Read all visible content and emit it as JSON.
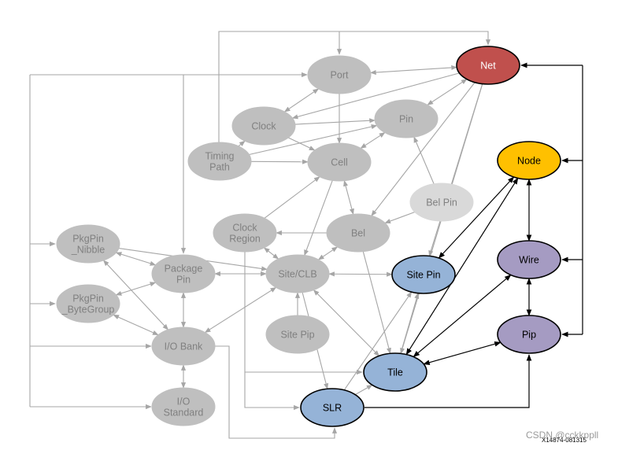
{
  "nodes": [
    {
      "id": "port",
      "label": [
        "Port"
      ],
      "fill": "#bfbfbf",
      "text": "#808080",
      "stroke": "#bfbfbf"
    },
    {
      "id": "net",
      "label": [
        "Net"
      ],
      "fill": "#c0504d",
      "text": "#ffffff",
      "stroke": "#000000"
    },
    {
      "id": "clock",
      "label": [
        "Clock"
      ],
      "fill": "#bfbfbf",
      "text": "#808080",
      "stroke": "#bfbfbf"
    },
    {
      "id": "pin",
      "label": [
        "Pin"
      ],
      "fill": "#bfbfbf",
      "text": "#808080",
      "stroke": "#bfbfbf"
    },
    {
      "id": "timing",
      "label": [
        "Timing",
        "Path"
      ],
      "fill": "#bfbfbf",
      "text": "#808080",
      "stroke": "#bfbfbf"
    },
    {
      "id": "cell",
      "label": [
        "Cell"
      ],
      "fill": "#bfbfbf",
      "text": "#808080",
      "stroke": "#bfbfbf"
    },
    {
      "id": "node",
      "label": [
        "Node"
      ],
      "fill": "#ffc000",
      "text": "#000000",
      "stroke": "#000000"
    },
    {
      "id": "belpin",
      "label": [
        "Bel Pin"
      ],
      "fill": "#d9d9d9",
      "text": "#808080",
      "stroke": "#d9d9d9"
    },
    {
      "id": "clkreg",
      "label": [
        "Clock",
        "Region"
      ],
      "fill": "#bfbfbf",
      "text": "#808080",
      "stroke": "#bfbfbf"
    },
    {
      "id": "bel",
      "label": [
        "Bel"
      ],
      "fill": "#bfbfbf",
      "text": "#808080",
      "stroke": "#bfbfbf"
    },
    {
      "id": "nibble",
      "label": [
        "PkgPin",
        "_Nibble"
      ],
      "fill": "#bfbfbf",
      "text": "#808080",
      "stroke": "#bfbfbf"
    },
    {
      "id": "pkgpin",
      "label": [
        "Package",
        "Pin"
      ],
      "fill": "#bfbfbf",
      "text": "#808080",
      "stroke": "#bfbfbf"
    },
    {
      "id": "site",
      "label": [
        "Site/CLB"
      ],
      "fill": "#bfbfbf",
      "text": "#808080",
      "stroke": "#bfbfbf"
    },
    {
      "id": "sitepin",
      "label": [
        "Site Pin"
      ],
      "fill": "#95b3d7",
      "text": "#000000",
      "stroke": "#000000"
    },
    {
      "id": "wire",
      "label": [
        "Wire"
      ],
      "fill": "#a59bc2",
      "text": "#000000",
      "stroke": "#000000"
    },
    {
      "id": "bytegroup",
      "label": [
        "PkgPin",
        "_ByteGroup"
      ],
      "fill": "#bfbfbf",
      "text": "#808080",
      "stroke": "#bfbfbf"
    },
    {
      "id": "iobank",
      "label": [
        "I/O Bank"
      ],
      "fill": "#bfbfbf",
      "text": "#808080",
      "stroke": "#bfbfbf"
    },
    {
      "id": "sitepip",
      "label": [
        "Site Pip"
      ],
      "fill": "#bfbfbf",
      "text": "#808080",
      "stroke": "#bfbfbf"
    },
    {
      "id": "pip",
      "label": [
        "Pip"
      ],
      "fill": "#a59bc2",
      "text": "#000000",
      "stroke": "#000000"
    },
    {
      "id": "tile",
      "label": [
        "Tile"
      ],
      "fill": "#95b3d7",
      "text": "#000000",
      "stroke": "#000000"
    },
    {
      "id": "iostd",
      "label": [
        "I/O",
        "Standard"
      ],
      "fill": "#bfbfbf",
      "text": "#808080",
      "stroke": "#bfbfbf"
    },
    {
      "id": "slr",
      "label": [
        "SLR"
      ],
      "fill": "#95b3d7",
      "text": "#000000",
      "stroke": "#000000"
    }
  ],
  "edges": [
    {
      "from": "port",
      "to": "net",
      "bi": true,
      "color": "gray"
    },
    {
      "from": "port",
      "to": "clock",
      "bi": true,
      "color": "gray"
    },
    {
      "from": "port",
      "to": "cell",
      "bi": false,
      "color": "gray"
    },
    {
      "from": "net",
      "to": "clock",
      "bi": false,
      "color": "gray"
    },
    {
      "from": "net",
      "to": "pin",
      "bi": true,
      "color": "gray"
    },
    {
      "from": "net",
      "to": "bel",
      "bi": false,
      "color": "gray"
    },
    {
      "from": "net",
      "to": "sitepin",
      "bi": false,
      "color": "gray"
    },
    {
      "from": "net",
      "to": "tile",
      "bi": false,
      "color": "gray"
    },
    {
      "from": "clock",
      "to": "pin",
      "bi": false,
      "color": "gray"
    },
    {
      "from": "clock",
      "to": "cell",
      "bi": false,
      "color": "gray"
    },
    {
      "from": "timing",
      "to": "clock",
      "bi": false,
      "color": "gray"
    },
    {
      "from": "timing",
      "to": "pin",
      "bi": false,
      "color": "gray"
    },
    {
      "from": "timing",
      "to": "cell",
      "bi": false,
      "color": "gray"
    },
    {
      "from": "cell",
      "to": "pin",
      "bi": true,
      "color": "gray"
    },
    {
      "from": "cell",
      "to": "bel",
      "bi": true,
      "color": "gray"
    },
    {
      "from": "cell",
      "to": "site",
      "bi": false,
      "color": "gray"
    },
    {
      "from": "clkreg",
      "to": "cell",
      "bi": false,
      "color": "gray"
    },
    {
      "from": "belpin",
      "to": "pin",
      "bi": false,
      "color": "gray"
    },
    {
      "from": "belpin",
      "to": "bel",
      "bi": false,
      "color": "gray"
    },
    {
      "from": "bel",
      "to": "clkreg",
      "bi": false,
      "color": "gray"
    },
    {
      "from": "bel",
      "to": "site",
      "bi": true,
      "color": "gray"
    },
    {
      "from": "bel",
      "to": "tile",
      "bi": false,
      "color": "gray"
    },
    {
      "from": "clkreg",
      "to": "site",
      "bi": true,
      "color": "gray"
    },
    {
      "from": "site",
      "to": "pkgpin",
      "bi": true,
      "color": "gray"
    },
    {
      "from": "site",
      "to": "sitepin",
      "bi": true,
      "color": "gray"
    },
    {
      "from": "site",
      "to": "tile",
      "bi": true,
      "color": "gray"
    },
    {
      "from": "site",
      "to": "iobank",
      "bi": true,
      "color": "gray"
    },
    {
      "from": "site",
      "to": "slr",
      "bi": false,
      "color": "gray"
    },
    {
      "from": "sitepip",
      "to": "site",
      "bi": false,
      "color": "gray"
    },
    {
      "from": "nibble",
      "to": "site",
      "bi": false,
      "color": "gray"
    },
    {
      "from": "nibble",
      "to": "pkgpin",
      "bi": true,
      "color": "gray"
    },
    {
      "from": "nibble",
      "to": "iobank",
      "bi": true,
      "color": "gray"
    },
    {
      "from": "bytegroup",
      "to": "pkgpin",
      "bi": true,
      "color": "gray"
    },
    {
      "from": "bytegroup",
      "to": "iobank",
      "bi": true,
      "color": "gray"
    },
    {
      "from": "pkgpin",
      "to": "iobank",
      "bi": true,
      "color": "gray"
    },
    {
      "from": "iobank",
      "to": "iostd",
      "bi": true,
      "color": "gray"
    },
    {
      "from": "tile",
      "to": "sitepin",
      "bi": false,
      "color": "gray"
    },
    {
      "from": "slr",
      "to": "sitepin",
      "bi": false,
      "color": "gray"
    },
    {
      "from": "slr",
      "to": "tile",
      "bi": false,
      "color": "gray"
    },
    {
      "from": "sitepin",
      "to": "node",
      "bi": true,
      "color": "black"
    },
    {
      "from": "node",
      "to": "tile",
      "bi": true,
      "color": "black"
    },
    {
      "from": "node",
      "to": "wire",
      "bi": true,
      "color": "black"
    },
    {
      "from": "wire",
      "to": "pip",
      "bi": true,
      "color": "black"
    },
    {
      "from": "wire",
      "to": "tile",
      "bi": true,
      "color": "black"
    },
    {
      "from": "pip",
      "to": "tile",
      "bi": true,
      "color": "black"
    }
  ],
  "figure_code": "X14874-081315",
  "watermark": "CSDN @cckkppll"
}
